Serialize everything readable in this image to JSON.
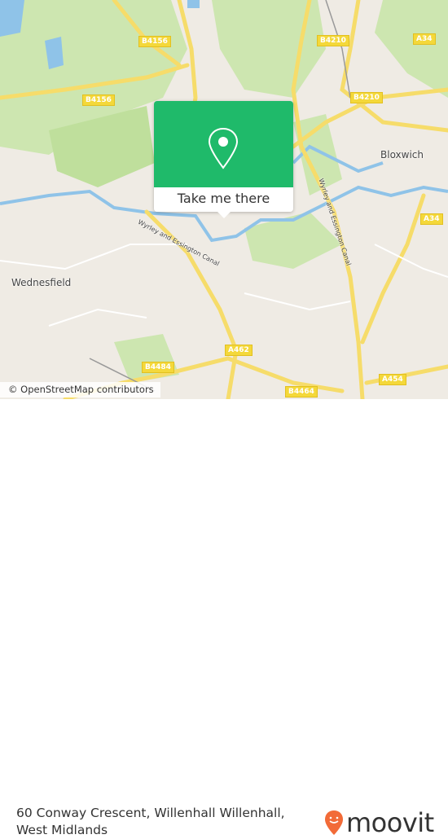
{
  "map": {
    "road_labels": [
      {
        "id": "b4156-top",
        "text": "B4156"
      },
      {
        "id": "b4210-top",
        "text": "B4210"
      },
      {
        "id": "a34-top",
        "text": "A34"
      },
      {
        "id": "b4156-left",
        "text": "B4156"
      },
      {
        "id": "b4210-right",
        "text": "B4210"
      },
      {
        "id": "a34-right",
        "text": "A34"
      },
      {
        "id": "a462",
        "text": "A462"
      },
      {
        "id": "b4484",
        "text": "B4484"
      },
      {
        "id": "b4464",
        "text": "B4464"
      },
      {
        "id": "a454",
        "text": "A454"
      }
    ],
    "places": [
      {
        "id": "bloxwich",
        "text": "Bloxwich"
      },
      {
        "id": "wednesfield",
        "text": "Wednesfield"
      }
    ],
    "canal_labels": [
      "Wyrley and Essington Canal",
      "Wyrley and Essington Canal"
    ],
    "attribution": "© OpenStreetMap contributors",
    "colors": {
      "background": "#efebe4",
      "green": "#cde6b0",
      "road": "#f6dc6a",
      "water": "#8fc3e8",
      "popup": "#1fba6a",
      "logo": "#f26b38"
    }
  },
  "popup": {
    "icon": "map-pin-icon",
    "button_label": "Take me there"
  },
  "footer": {
    "address": "60 Conway Crescent, Willenhall Willenhall, West Midlands",
    "logo_text": "moovit"
  }
}
